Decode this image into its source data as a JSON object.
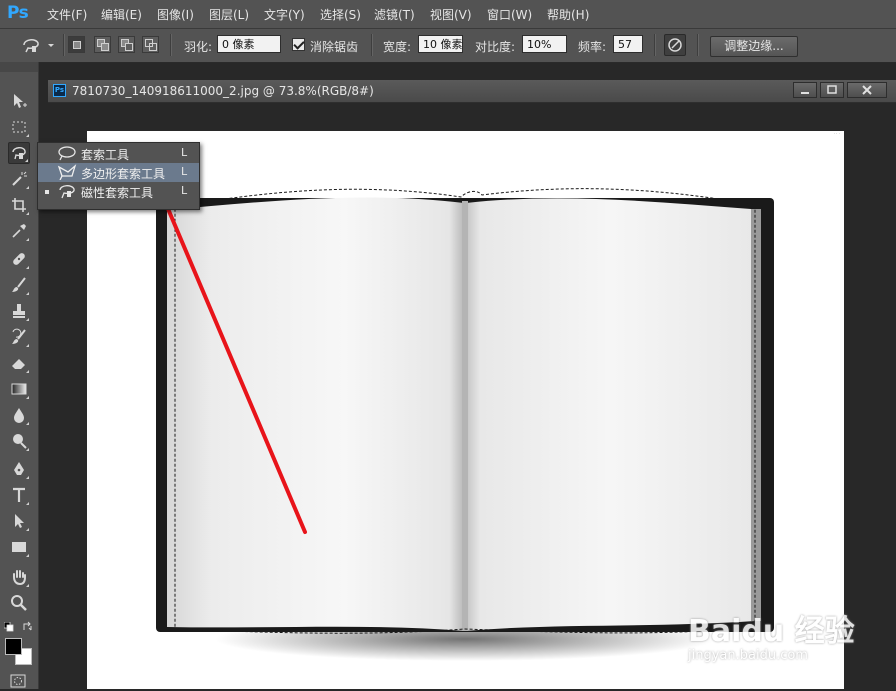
{
  "app": {
    "logo": "Ps"
  },
  "menubar": {
    "items": [
      "文件(F)",
      "编辑(E)",
      "图像(I)",
      "图层(L)",
      "文字(Y)",
      "选择(S)",
      "滤镜(T)",
      "视图(V)",
      "窗口(W)",
      "帮助(H)"
    ]
  },
  "options": {
    "feather_label": "羽化:",
    "feather_value": "0 像素",
    "antialias_label": "消除锯齿",
    "antialias_checked": true,
    "width_label": "宽度:",
    "width_value": "10 像素",
    "contrast_label": "对比度:",
    "contrast_value": "10%",
    "frequency_label": "频率:",
    "frequency_value": "57",
    "refine_edge_label": "调整边缘..."
  },
  "document": {
    "title": "7810730_140918611000_2.jpg @ 73.8%(RGB/8#)",
    "icon_label": "Ps"
  },
  "tool_flyout": {
    "items": [
      {
        "label": "套索工具",
        "shortcut": "L",
        "icon": "lasso-icon",
        "highlighted": false,
        "current": false
      },
      {
        "label": "多边形套索工具",
        "shortcut": "L",
        "icon": "polygonal-lasso-icon",
        "highlighted": true,
        "current": false
      },
      {
        "label": "磁性套索工具",
        "shortcut": "L",
        "icon": "magnetic-lasso-icon",
        "highlighted": false,
        "current": true
      }
    ]
  },
  "tools": [
    "move-icon",
    "marquee-icon",
    "magnetic-lasso-icon",
    "magic-wand-icon",
    "crop-icon",
    "eyedropper-icon",
    "healing-icon",
    "brush-icon",
    "stamp-icon",
    "history-brush-icon",
    "eraser-icon",
    "gradient-icon",
    "blur-icon",
    "dodge-icon",
    "pen-icon",
    "type-icon",
    "path-select-icon",
    "rectangle-icon",
    "hand-icon",
    "zoom-icon"
  ],
  "colors": {
    "foreground": "#000000",
    "background": "#ffffff",
    "highlight": "#6b7a8d",
    "arrow": "#e8141a"
  },
  "watermark": {
    "brand": "Baidu 经验",
    "url": "jingyan.baidu.com"
  }
}
